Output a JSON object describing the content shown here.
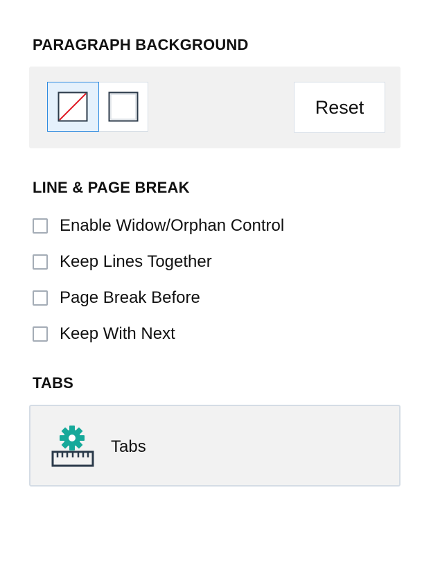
{
  "paragraph_background": {
    "title": "PARAGRAPH BACKGROUND",
    "swatches": [
      {
        "name": "no-color",
        "selected": true,
        "slash_color": "#e0202a"
      },
      {
        "name": "white",
        "selected": false,
        "color": "#ffffff"
      }
    ],
    "reset_label": "Reset"
  },
  "line_page_break": {
    "title": "LINE & PAGE BREAK",
    "options": [
      {
        "label": "Enable Widow/Orphan Control",
        "checked": false
      },
      {
        "label": "Keep Lines Together",
        "checked": false
      },
      {
        "label": "Page Break Before",
        "checked": false
      },
      {
        "label": "Keep With Next",
        "checked": false
      }
    ]
  },
  "tabs": {
    "title": "TABS",
    "button_label": "Tabs",
    "icon": "gear-ruler-icon"
  },
  "colors": {
    "accent_blue": "#2f8be0",
    "selected_bg": "#e5f1fc",
    "gear_teal": "#16a99a",
    "ruler_dark": "#2b3a4a",
    "panel_gray": "#f1f1f1"
  }
}
